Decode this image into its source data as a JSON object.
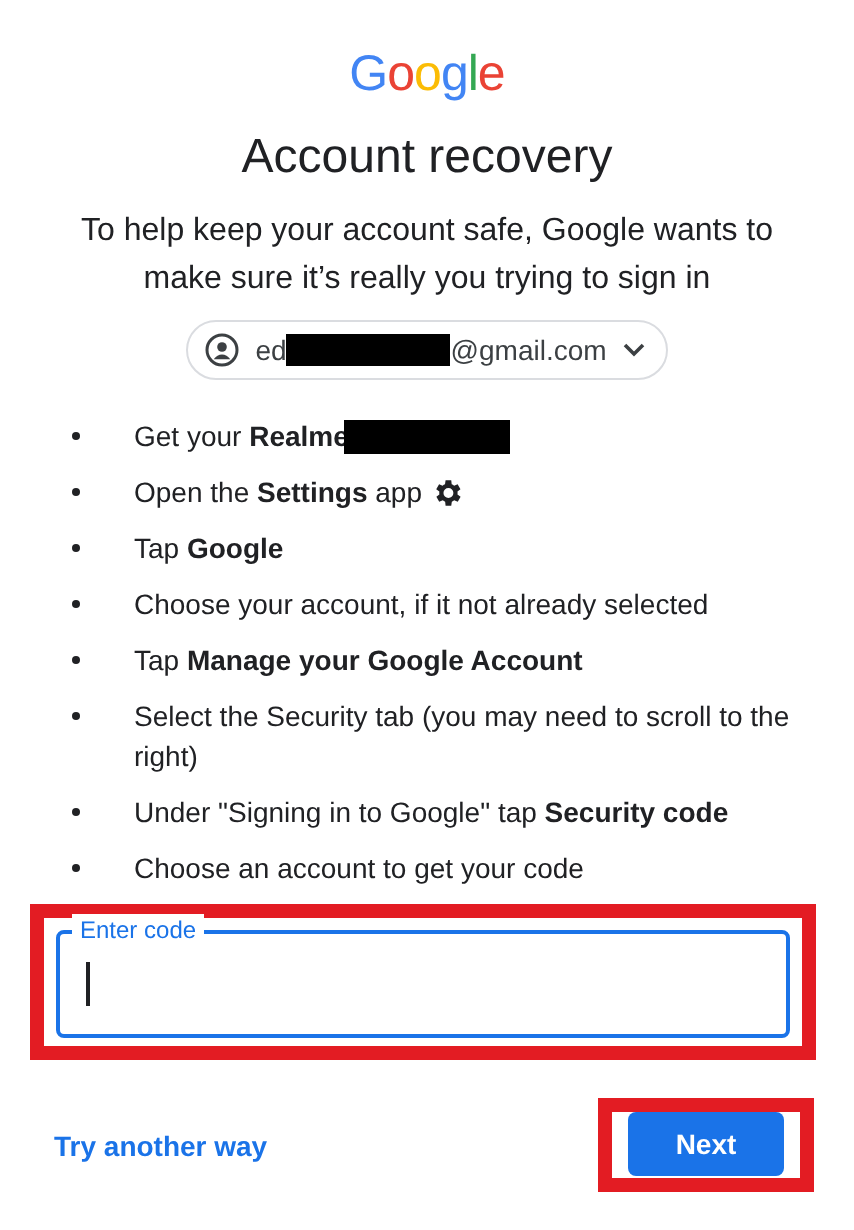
{
  "logo": "Google",
  "title": "Account recovery",
  "subtitle": "To help keep your account safe, Google wants to make sure it’s really you trying to sign in",
  "account_chip": {
    "email_start": "ed",
    "email_redacted": true,
    "email_end": "@gmail.com"
  },
  "steps": [
    {
      "kind": "redacted",
      "text": "Get your **Realme**"
    },
    {
      "kind": "gear",
      "text": "Open the **Settings** app"
    },
    {
      "kind": "text",
      "text": "Tap **Google**"
    },
    {
      "kind": "text",
      "text": "Choose your account, if it not already selected"
    },
    {
      "kind": "text",
      "text": "Tap **Manage your Google Account**"
    },
    {
      "kind": "text",
      "text": "Select the Security tab (you may need to scroll to the right)"
    },
    {
      "kind": "text",
      "text": "Under \"Signing in to Google\" tap **Security code**"
    },
    {
      "kind": "text",
      "text": "Choose an account to get your code"
    }
  ],
  "code_field": {
    "label": "Enter code",
    "focused": true,
    "highlighted": true
  },
  "try_another_way": "Try another way",
  "next_button": {
    "label": "Next",
    "highlighted": true
  }
}
